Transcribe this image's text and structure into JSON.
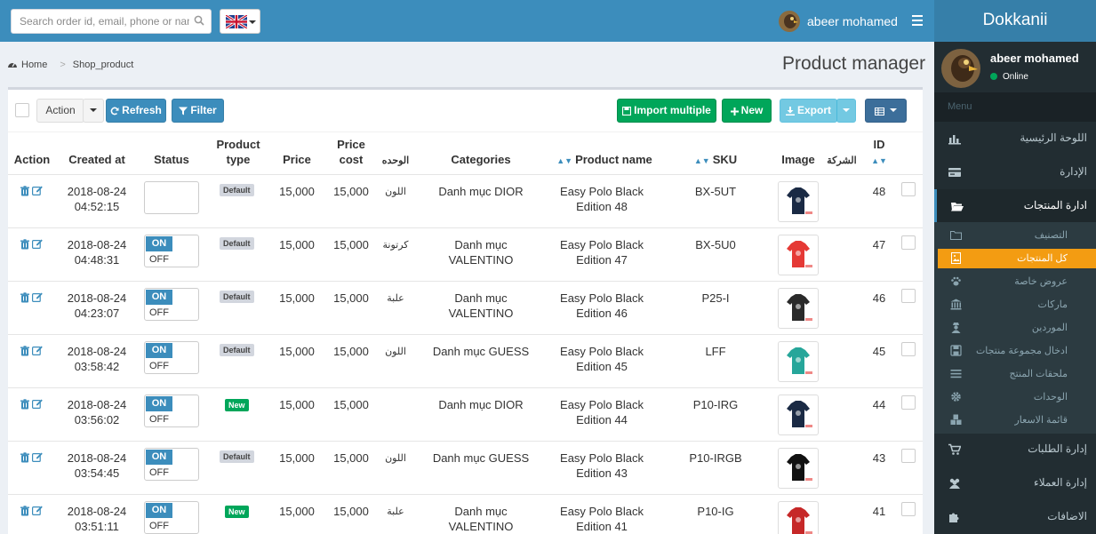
{
  "search": {
    "placeholder": "Search order id, email, phone or nam"
  },
  "user": {
    "name": "abeer mohamed",
    "status": "Online"
  },
  "brand": "Dokkanii",
  "menu": {
    "header": "Menu",
    "items": [
      {
        "label": "اللوحة الرئيسية",
        "icon": "chart-icon"
      },
      {
        "label": "الإدارة",
        "icon": "credit-card-icon"
      },
      {
        "label": "ادارة المنتجات",
        "icon": "folder-open-icon"
      },
      {
        "label": "إدارة الطلبات",
        "icon": "cart-icon"
      },
      {
        "label": "إدارة العملاء",
        "icon": "users-icon"
      },
      {
        "label": "الاضافات",
        "icon": "puzzle-icon"
      }
    ],
    "subitems": [
      {
        "label": "التصنيف",
        "icon": "folder-icon"
      },
      {
        "label": "كل المنتجات",
        "icon": "file-image-icon"
      },
      {
        "label": "عروض خاصة",
        "icon": "paw-icon"
      },
      {
        "label": "ماركات",
        "icon": "bank-icon"
      },
      {
        "label": "الموردين",
        "icon": "user-secret-icon"
      },
      {
        "label": "ادخال مجموعة منتجات",
        "icon": "save-icon"
      },
      {
        "label": "ملحقات المنتج",
        "icon": "bars-icon"
      },
      {
        "label": "الوحدات",
        "icon": "cog-icon"
      },
      {
        "label": "قائمة الاسعار",
        "icon": "cubes-icon"
      }
    ]
  },
  "breadcrumb": {
    "home": "Home",
    "current": "Shop_product"
  },
  "page_title": "Product manager",
  "toolbar": {
    "action": "Action",
    "refresh": "Refresh",
    "filter": "Filter",
    "import": "Import multiple",
    "new": "New",
    "export": "Export"
  },
  "table": {
    "headers": {
      "action": "Action",
      "created": "Created at",
      "status": "Status",
      "ptype": "Product type",
      "price": "Price",
      "cost": "Price cost",
      "unit": "الوحده",
      "categories": "Categories",
      "pname": "Product name",
      "sku": "SKU",
      "image": "Image",
      "company": "الشركة",
      "id": "ID"
    },
    "toggle": {
      "on": "ON",
      "off": "OFF"
    },
    "rows": [
      {
        "date": "2018-08-24",
        "time": "04:52:15",
        "status": "",
        "type": "Default",
        "price": "15,000",
        "cost": "15,000",
        "unit": "اللون",
        "category": "Danh mục DIOR",
        "name1": "Easy Polo Black",
        "name2": "Edition 48",
        "sku": "BX-5UT",
        "id": "48",
        "shirt": "#1a2a44"
      },
      {
        "date": "2018-08-24",
        "time": "04:48:31",
        "status": "on",
        "type": "Default",
        "price": "15,000",
        "cost": "15,000",
        "unit": "كرتونة",
        "category": "Danh mục VALENTINO",
        "name1": "Easy Polo Black",
        "name2": "Edition 47",
        "sku": "BX-5U0",
        "id": "47",
        "shirt": "#e53935"
      },
      {
        "date": "2018-08-24",
        "time": "04:23:07",
        "status": "on",
        "type": "Default",
        "price": "15,000",
        "cost": "15,000",
        "unit": "علبة",
        "category": "Danh mục VALENTINO",
        "name1": "Easy Polo Black",
        "name2": "Edition 46",
        "sku": "P25-I",
        "id": "46",
        "shirt": "#2a2a2a"
      },
      {
        "date": "2018-08-24",
        "time": "03:58:42",
        "status": "on",
        "type": "Default",
        "price": "15,000",
        "cost": "15,000",
        "unit": "اللون",
        "category": "Danh mục GUESS",
        "name1": "Easy Polo Black",
        "name2": "Edition 45",
        "sku": "LFF",
        "id": "45",
        "shirt": "#26a69a"
      },
      {
        "date": "2018-08-24",
        "time": "03:56:02",
        "status": "on",
        "type": "New",
        "price": "15,000",
        "cost": "15,000",
        "unit": "",
        "category": "Danh mục DIOR",
        "name1": "Easy Polo Black",
        "name2": "Edition 44",
        "sku": "P10-IRG",
        "id": "44",
        "shirt": "#1a2a44"
      },
      {
        "date": "2018-08-24",
        "time": "03:54:45",
        "status": "on",
        "type": "Default",
        "price": "15,000",
        "cost": "15,000",
        "unit": "اللون",
        "category": "Danh mục GUESS",
        "name1": "Easy Polo Black",
        "name2": "Edition 43",
        "sku": "P10-IRGB",
        "id": "43",
        "shirt": "#111111"
      },
      {
        "date": "2018-08-24",
        "time": "03:51:11",
        "status": "on",
        "type": "New",
        "price": "15,000",
        "cost": "15,000",
        "unit": "علبة",
        "category": "Danh mục VALENTINO",
        "name1": "Easy Polo Black",
        "name2": "Edition 41",
        "sku": "P10-IG",
        "id": "41",
        "shirt": "#c62828"
      }
    ]
  }
}
